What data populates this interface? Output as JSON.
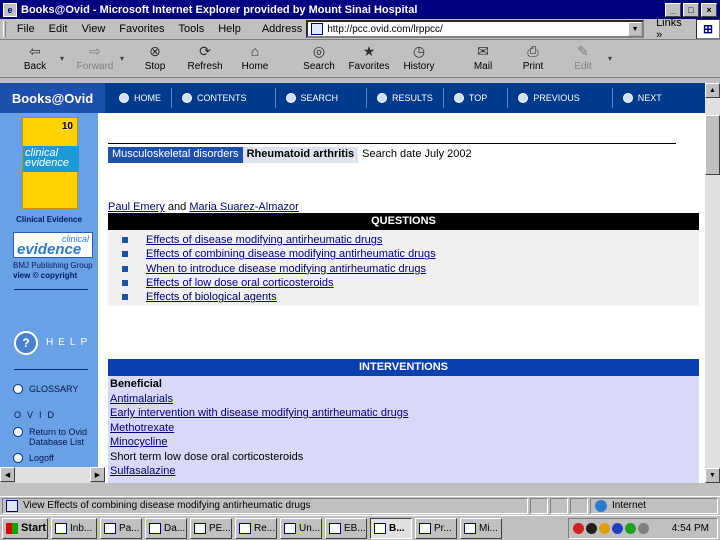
{
  "window": {
    "title": "Books@Ovid - Microsoft Internet Explorer provided by Mount Sinai Hospital",
    "minimize": "_",
    "maximize": "□",
    "close": "×"
  },
  "menu": {
    "items": [
      "File",
      "Edit",
      "View",
      "Favorites",
      "Tools",
      "Help"
    ],
    "address_label": "Address",
    "address_value": "http://pcc.ovid.com/lrppcc/",
    "links_label": "Links »"
  },
  "toolbar": {
    "back": "Back",
    "forward": "Forward",
    "stop": "Stop",
    "refresh": "Refresh",
    "home": "Home",
    "search": "Search",
    "favorites": "Favorites",
    "history": "History",
    "mail": "Mail",
    "print": "Print",
    "edit": "Edit"
  },
  "ovid_nav": {
    "brand": "Books@Ovid",
    "items": [
      "HOME",
      "CONTENTS",
      "SEARCH",
      "RESULTS",
      "TOP",
      "PREVIOUS",
      "NEXT"
    ]
  },
  "sidebar": {
    "cover_number": "10",
    "cover_text": "clinical evidence",
    "clinical_evidence_label": "Clinical Evidence",
    "logo_line1": "clinical",
    "logo_line2": "evidence",
    "publisher": "BMJ Publishing Group",
    "copyright": "view © copyright",
    "help_icon_text": "?",
    "help_text": "HELP",
    "glossary": "GLOSSARY",
    "ovid_label": "OVID",
    "return_line1": "Return to Ovid",
    "return_line2": "Database List",
    "logoff": "Logoff"
  },
  "main": {
    "breadcrumb_section": "Musculoskeletal disorders",
    "breadcrumb_topic": "Rheumatoid arthritis",
    "search_date": "Search date July 2002",
    "author1": "Paul Emery",
    "author_and": "and",
    "author2": "Maria Suarez-Almazor",
    "questions_header": "QUESTIONS",
    "questions": [
      "Effects of disease modifying antirheumatic drugs",
      "Effects of combining disease modifying antirheumatic drugs",
      "When to introduce disease modifying antirheumatic drugs",
      "Effects of low dose oral corticosteroids",
      "Effects of biological agents"
    ],
    "interventions_header": "INTERVENTIONS",
    "beneficial_label": "Beneficial",
    "interventions": [
      {
        "text": "Antimalarials",
        "link": true
      },
      {
        "text": "Early intervention with disease modifying antirheumatic drugs",
        "link": true
      },
      {
        "text": "Methotrexate",
        "link": true
      },
      {
        "text": "Minocycline",
        "link": true
      },
      {
        "text": "Short term low dose oral corticosteroids",
        "link": false
      },
      {
        "text": "Sulfasalazine",
        "link": true
      }
    ]
  },
  "status": {
    "message": "View Effects of combining disease modifying antirheumatic drugs",
    "zone": "Internet"
  },
  "taskbar": {
    "start": "Start",
    "tasks": [
      "Inb...",
      "Pa...",
      "Da...",
      "PE...",
      "Re...",
      "Un...",
      "EB...",
      "B...",
      "Pr...",
      "Mi..."
    ],
    "clock": "4:54 PM"
  }
}
